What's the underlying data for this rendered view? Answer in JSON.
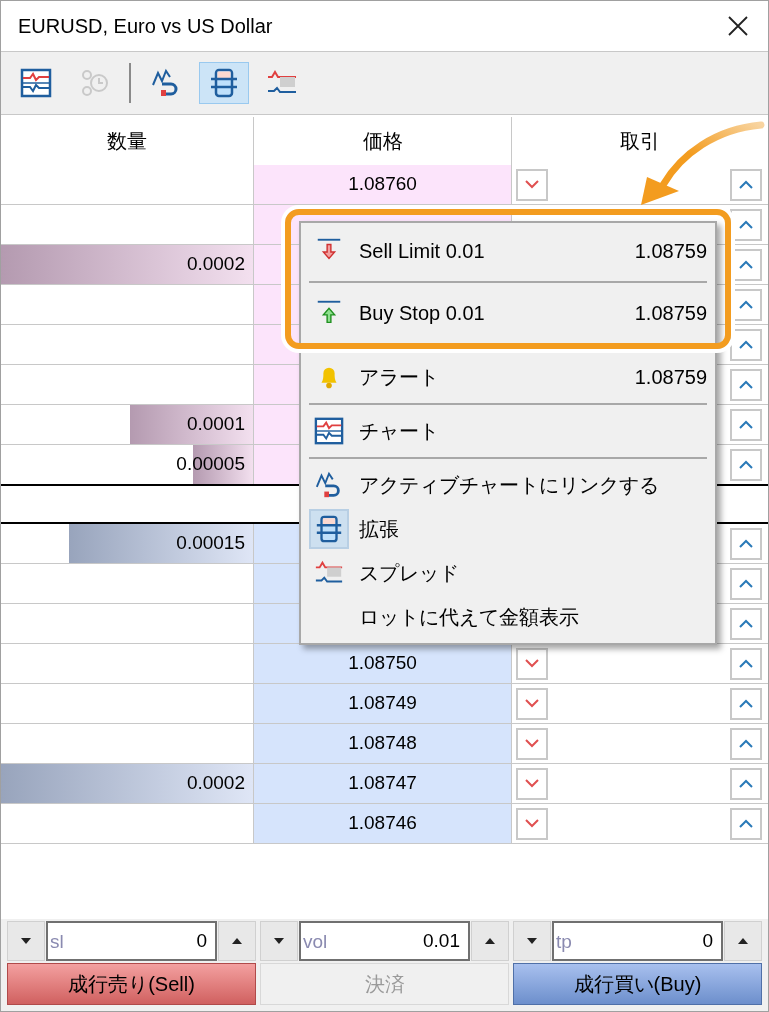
{
  "window": {
    "title": "EURUSD, Euro vs US Dollar"
  },
  "toolbar": [
    {
      "kind": "chart",
      "disabled": false,
      "pressed": false
    },
    {
      "kind": "clock",
      "disabled": true,
      "pressed": false
    },
    {
      "kind": "link",
      "disabled": false,
      "pressed": false
    },
    {
      "kind": "expand",
      "disabled": false,
      "pressed": true
    },
    {
      "kind": "spread",
      "disabled": false,
      "pressed": false
    }
  ],
  "table": {
    "columns": [
      "数量",
      "価格",
      "取引"
    ],
    "ask_rows": [
      {
        "price": "1.08760",
        "sell_button": true
      },
      {
        "sell_button": false
      },
      {
        "volume": "0.0002",
        "level": 1.0,
        "sell_button": false
      },
      {
        "sell_button": false
      },
      {
        "sell_button": false
      },
      {
        "sell_button": false
      },
      {
        "volume": "0.0001",
        "level": 0.49,
        "sell_button": false
      },
      {
        "volume": "0.00005",
        "level": 0.24,
        "sell_button": false
      }
    ],
    "bid_rows": [
      {
        "volume": "0.00015",
        "level": 0.73,
        "sell_button": false
      },
      {
        "sell_button": false
      },
      {
        "sell_button": false
      },
      {
        "price": "1.08750",
        "sell_button": true
      },
      {
        "price": "1.08749",
        "sell_button": true
      },
      {
        "price": "1.08748",
        "sell_button": true
      },
      {
        "volume": "0.0002",
        "level": 1.0,
        "price": "1.08747",
        "sell_button": true
      },
      {
        "price": "1.08746",
        "sell_button": true
      }
    ]
  },
  "context_menu": {
    "items": [
      {
        "kind": "sell_limit",
        "label": "Sell Limit 0.01",
        "value": "1.08759",
        "highlighted": true
      },
      {
        "kind": "separator",
        "highlighted": true
      },
      {
        "kind": "buy_stop",
        "label": "Buy Stop 0.01",
        "value": "1.08759",
        "highlighted": true
      },
      {
        "kind": "alert",
        "label": "アラート",
        "value": "1.08759",
        "highlighted": false
      },
      {
        "kind": "separator",
        "highlighted": false
      },
      {
        "kind": "chart",
        "label": "チャート",
        "highlighted": false
      },
      {
        "kind": "separator",
        "highlighted": false
      },
      {
        "kind": "link",
        "label": "アクティブチャートにリンクする",
        "checked": false,
        "highlighted": false
      },
      {
        "kind": "expand",
        "label": "拡張",
        "checked": true,
        "highlighted": false
      },
      {
        "kind": "spread",
        "label": "スプレッド",
        "checked": false,
        "highlighted": false
      },
      {
        "kind": "plain",
        "label": "ロットに代えて金額表示",
        "highlighted": false
      }
    ]
  },
  "order_fields": [
    {
      "placeholder": "sl",
      "value": "0"
    },
    {
      "placeholder": "vol",
      "value": "0.01"
    },
    {
      "placeholder": "tp",
      "value": "0"
    }
  ],
  "buttons": [
    {
      "kind": "sell",
      "label": "成行売り(Sell)",
      "disabled": false
    },
    {
      "kind": "close",
      "label": "決済",
      "disabled": true
    },
    {
      "kind": "buy",
      "label": "成行買い(Buy)",
      "disabled": false
    }
  ]
}
